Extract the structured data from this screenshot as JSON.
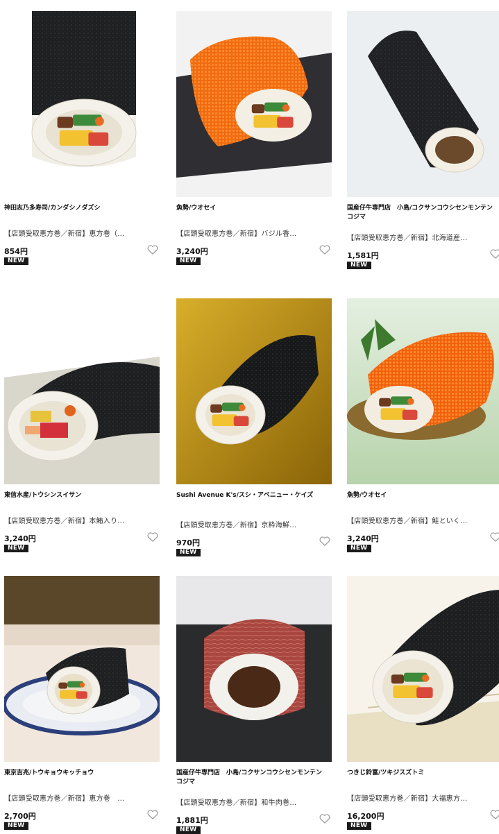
{
  "products": [
    {
      "store": "神田志乃多寿司/カンダシノダズシ",
      "desc": "【店頭受取恵方巻／新宿】恵方巻（…",
      "price": "854円",
      "badge": "NEW",
      "style": "nori-closeup"
    },
    {
      "store": "魚勢/ウオセイ",
      "desc": "【店頭受取恵方巻／新宿】バジル香…",
      "price": "3,240円",
      "badge": "NEW",
      "style": "orange-roe-slate"
    },
    {
      "store": "国産仔牛専門店　小島/コクサンコウシセンモンテン　コジマ",
      "desc": "【店頭受取恵方巻／新宿】北海道産…",
      "price": "1,581円",
      "badge": "NEW",
      "style": "nori-standing"
    },
    {
      "store": "東信水産/トウシンスイサン",
      "desc": "【店頭受取恵方巻／新宿】本鮪入り…",
      "price": "3,240円",
      "badge": "NEW",
      "style": "nori-seafood-plate"
    },
    {
      "store": "Sushi Avenue K's/スシ・アベニュー・ケイズ",
      "desc": "【店頭受取恵方巻／新宿】京粋海鮮…",
      "price": "970円",
      "badge": "NEW",
      "style": "nori-gold"
    },
    {
      "store": "魚勢/ウオセイ",
      "desc": "【店頭受取恵方巻／新宿】鮭といく…",
      "price": "3,240円",
      "badge": "NEW",
      "style": "orange-roe-green"
    },
    {
      "store": "東京吉兆/トウキョウキッチョウ",
      "desc": "【店頭受取恵方巻／新宿】恵方巻　…",
      "price": "2,700円",
      "badge": "NEW",
      "style": "nori-blue-plate"
    },
    {
      "store": "国産仔牛専門店　小島/コクサンコウシセンモンテン　コジマ",
      "desc": "【店頭受取恵方巻／新宿】和牛肉巻…",
      "price": "1,881円",
      "badge": "NEW",
      "style": "beef-roll"
    },
    {
      "store": "つきじ鈴富/ツキジスズトミ",
      "desc": "【店頭受取恵方巻／新宿】大福恵方…",
      "price": "16,200円",
      "badge": "NEW",
      "style": "nori-bamboo"
    }
  ]
}
